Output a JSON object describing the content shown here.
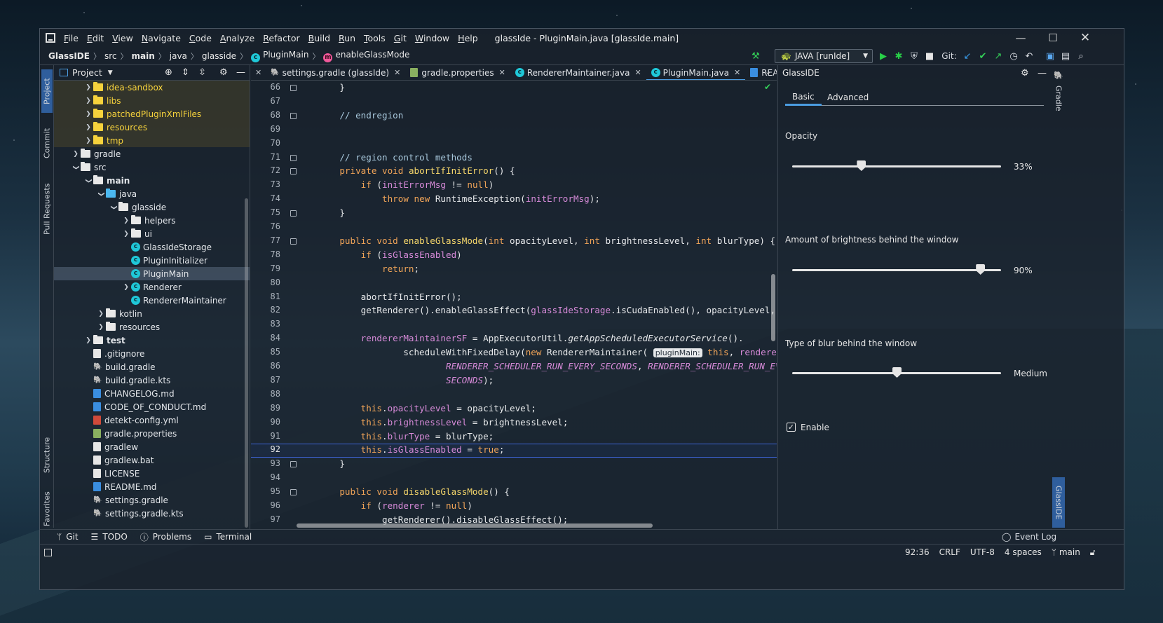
{
  "window": {
    "title": "glassIde - PluginMain.java [glassIde.main]"
  },
  "menu": [
    "File",
    "Edit",
    "View",
    "Navigate",
    "Code",
    "Analyze",
    "Refactor",
    "Build",
    "Run",
    "Tools",
    "Git",
    "Window",
    "Help"
  ],
  "breadcrumb": [
    "GlassIDE",
    "src",
    "main",
    "java",
    "glasside",
    "PluginMain",
    "enableGlassMode"
  ],
  "run_config": "JAVA [runIde]",
  "git_label": "Git:",
  "left_stripe": [
    "Project",
    "Commit",
    "Pull Requests",
    "Structure",
    "Favorites"
  ],
  "project_panel": {
    "title": "Project"
  },
  "tree": [
    {
      "label": "idea-sandbox",
      "indent": 2,
      "arrow": "›",
      "type": "excl"
    },
    {
      "label": "libs",
      "indent": 2,
      "arrow": "›",
      "type": "excl"
    },
    {
      "label": "patchedPluginXmlFiles",
      "indent": 2,
      "arrow": "›",
      "type": "excl"
    },
    {
      "label": "resources",
      "indent": 2,
      "arrow": "›",
      "type": "excl"
    },
    {
      "label": "tmp",
      "indent": 2,
      "arrow": "›",
      "type": "excl"
    },
    {
      "label": "gradle",
      "indent": 1,
      "arrow": "›",
      "type": "folder"
    },
    {
      "label": "src",
      "indent": 1,
      "arrow": "⌄",
      "type": "folder"
    },
    {
      "label": "main",
      "indent": 2,
      "arrow": "⌄",
      "type": "folder",
      "bold": true
    },
    {
      "label": "java",
      "indent": 3,
      "arrow": "⌄",
      "type": "srcfolder"
    },
    {
      "label": "glasside",
      "indent": 4,
      "arrow": "⌄",
      "type": "pkg"
    },
    {
      "label": "helpers",
      "indent": 5,
      "arrow": "›",
      "type": "pkg"
    },
    {
      "label": "ui",
      "indent": 5,
      "arrow": "›",
      "type": "pkg"
    },
    {
      "label": "GlassIdeStorage",
      "indent": 5,
      "arrow": "",
      "type": "class"
    },
    {
      "label": "PluginInitializer",
      "indent": 5,
      "arrow": "",
      "type": "class"
    },
    {
      "label": "PluginMain",
      "indent": 5,
      "arrow": "",
      "type": "class",
      "selected": true
    },
    {
      "label": "Renderer",
      "indent": 5,
      "arrow": "›",
      "type": "class"
    },
    {
      "label": "RendererMaintainer",
      "indent": 5,
      "arrow": "",
      "type": "class"
    },
    {
      "label": "kotlin",
      "indent": 3,
      "arrow": "›",
      "type": "folder"
    },
    {
      "label": "resources",
      "indent": 3,
      "arrow": "›",
      "type": "resfolder"
    },
    {
      "label": "test",
      "indent": 2,
      "arrow": "›",
      "type": "folder",
      "bold": true
    },
    {
      "label": ".gitignore",
      "indent": 2,
      "arrow": "",
      "type": "file"
    },
    {
      "label": "build.gradle",
      "indent": 2,
      "arrow": "",
      "type": "gradle"
    },
    {
      "label": "build.gradle.kts",
      "indent": 2,
      "arrow": "",
      "type": "gradle"
    },
    {
      "label": "CHANGELOG.md",
      "indent": 2,
      "arrow": "",
      "type": "md"
    },
    {
      "label": "CODE_OF_CONDUCT.md",
      "indent": 2,
      "arrow": "",
      "type": "md"
    },
    {
      "label": "detekt-config.yml",
      "indent": 2,
      "arrow": "",
      "type": "yml"
    },
    {
      "label": "gradle.properties",
      "indent": 2,
      "arrow": "",
      "type": "props"
    },
    {
      "label": "gradlew",
      "indent": 2,
      "arrow": "",
      "type": "exec"
    },
    {
      "label": "gradlew.bat",
      "indent": 2,
      "arrow": "",
      "type": "file"
    },
    {
      "label": "LICENSE",
      "indent": 2,
      "arrow": "",
      "type": "file"
    },
    {
      "label": "README.md",
      "indent": 2,
      "arrow": "",
      "type": "md"
    },
    {
      "label": "settings.gradle",
      "indent": 2,
      "arrow": "",
      "type": "gradle"
    },
    {
      "label": "settings.gradle.kts",
      "indent": 2,
      "arrow": "",
      "type": "gradle"
    }
  ],
  "tabs": [
    {
      "label": "settings.gradle (glassIde)",
      "icon": "gradle"
    },
    {
      "label": "gradle.properties",
      "icon": "props"
    },
    {
      "label": "RendererMaintainer.java",
      "icon": "class"
    },
    {
      "label": "PluginMain.java",
      "icon": "class",
      "active": true
    },
    {
      "label": "README.md",
      "icon": "md"
    }
  ],
  "code": [
    {
      "n": "66",
      "c": "    }"
    },
    {
      "n": "67",
      "c": ""
    },
    {
      "n": "68",
      "c": "    <span class=\"cm\">// endregion</span>"
    },
    {
      "n": "69",
      "c": ""
    },
    {
      "n": "70",
      "c": ""
    },
    {
      "n": "71",
      "c": "    <span class=\"cm\">// region control methods</span>"
    },
    {
      "n": "72",
      "c": "    <span class=\"kw\">private void</span> <span class=\"fn\">abortIfInitError</span>() {"
    },
    {
      "n": "73",
      "c": "        <span class=\"kw\">if</span> (<span class=\"fd\">initErrorMsg</span> != <span class=\"kw\">null</span>)"
    },
    {
      "n": "74",
      "c": "            <span class=\"kw\">throw new</span> RuntimeException(<span class=\"fd\">initErrorMsg</span>);"
    },
    {
      "n": "75",
      "c": "    }"
    },
    {
      "n": "76",
      "c": ""
    },
    {
      "n": "77",
      "c": "    <span class=\"kw\">public void</span> <span class=\"fn\">enableGlassMode</span>(<span class=\"kw\">int</span> opacityLevel, <span class=\"kw\">int</span> brightnessLevel, <span class=\"kw\">int</span> blurType) {"
    },
    {
      "n": "78",
      "c": "        <span class=\"kw\">if</span> (<span class=\"fd\">isGlassEnabled</span>)"
    },
    {
      "n": "79",
      "c": "            <span class=\"kw\">return</span>;"
    },
    {
      "n": "80",
      "c": ""
    },
    {
      "n": "81",
      "c": "        abortIfInitError();"
    },
    {
      "n": "82",
      "c": "        getRenderer().enableGlassEffect(<span class=\"fd\">glassIdeStorage</span>.isCudaEnabled(), opacityLevel, bri"
    },
    {
      "n": "83",
      "c": ""
    },
    {
      "n": "84",
      "c": "        <span class=\"fd\">rendererMaintainerSF</span> = AppExecutorUtil.<span class=\"it\">getAppScheduledExecutorService</span>()."
    },
    {
      "n": "85",
      "c": "                scheduleWithFixedDelay(<span class=\"kw\">new</span> RendererMaintainer( <span class=\"hint\">pluginMain:</span> <span class=\"kw\">this</span>, <span class=\"fd\">renderer</span>),"
    },
    {
      "n": "86",
      "c": "                        <span class=\"fd it\">RENDERER_SCHEDULER_RUN_EVERY_SECONDS</span>, <span class=\"fd it\">RENDERER_SCHEDULER_RUN_EVERY_</span>"
    },
    {
      "n": "87",
      "c": "                        <span class=\"fd it\">SECONDS</span>);"
    },
    {
      "n": "88",
      "c": ""
    },
    {
      "n": "89",
      "c": "        <span class=\"kw\">this</span>.<span class=\"fd\">opacityLevel</span> = opacityLevel;"
    },
    {
      "n": "90",
      "c": "        <span class=\"kw\">this</span>.<span class=\"fd\">brightnessLevel</span> = brightnessLevel;"
    },
    {
      "n": "91",
      "c": "        <span class=\"kw\">this</span>.<span class=\"fd\">blurType</span> = blurType;"
    },
    {
      "n": "92",
      "c": "        <span class=\"kw\">this</span>.<span class=\"fd\">isGlassEnabled</span> = <span class=\"kw\">true</span>;"
    },
    {
      "n": "93",
      "c": "    }"
    },
    {
      "n": "94",
      "c": ""
    },
    {
      "n": "95",
      "c": "    <span class=\"kw\">public void</span> <span class=\"fn\">disableGlassMode</span>() {"
    },
    {
      "n": "96",
      "c": "        <span class=\"kw\">if</span> (<span class=\"fd\">renderer</span> != <span class=\"kw\">null</span>)"
    },
    {
      "n": "97",
      "c": "            getRenderer().disableGlassEffect();"
    }
  ],
  "current_line": "92",
  "glass_panel": {
    "title": "GlassIDE",
    "tabs": [
      "Basic",
      "Advanced"
    ],
    "opacity": {
      "label": "Opacity",
      "value": "33%",
      "level": 0.33
    },
    "brightness": {
      "label": "Amount of brightness behind the window",
      "value": "90%",
      "level": 0.9
    },
    "blur": {
      "label": "Type of blur behind the window",
      "value": "Medium",
      "level": 0.5
    },
    "enable_label": "Enable",
    "enabled": true
  },
  "right_stripe": [
    "Gradle",
    "GlassIDE"
  ],
  "bottom_tools": [
    {
      "label": "Git",
      "icon": "git-branch-icon"
    },
    {
      "label": "TODO",
      "icon": "list-icon"
    },
    {
      "label": "Problems",
      "icon": "info-icon"
    },
    {
      "label": "Terminal",
      "icon": "terminal-icon"
    }
  ],
  "event_log": "Event Log",
  "status": {
    "position": "92:36",
    "line_sep": "CRLF",
    "encoding": "UTF-8",
    "indent": "4 spaces",
    "branch": "main"
  },
  "colors": {
    "accent": "#4b9ce0",
    "class_icon": "#1fc8d8",
    "excluded_folder": "#f6d23c",
    "run_green": "#28d048"
  }
}
